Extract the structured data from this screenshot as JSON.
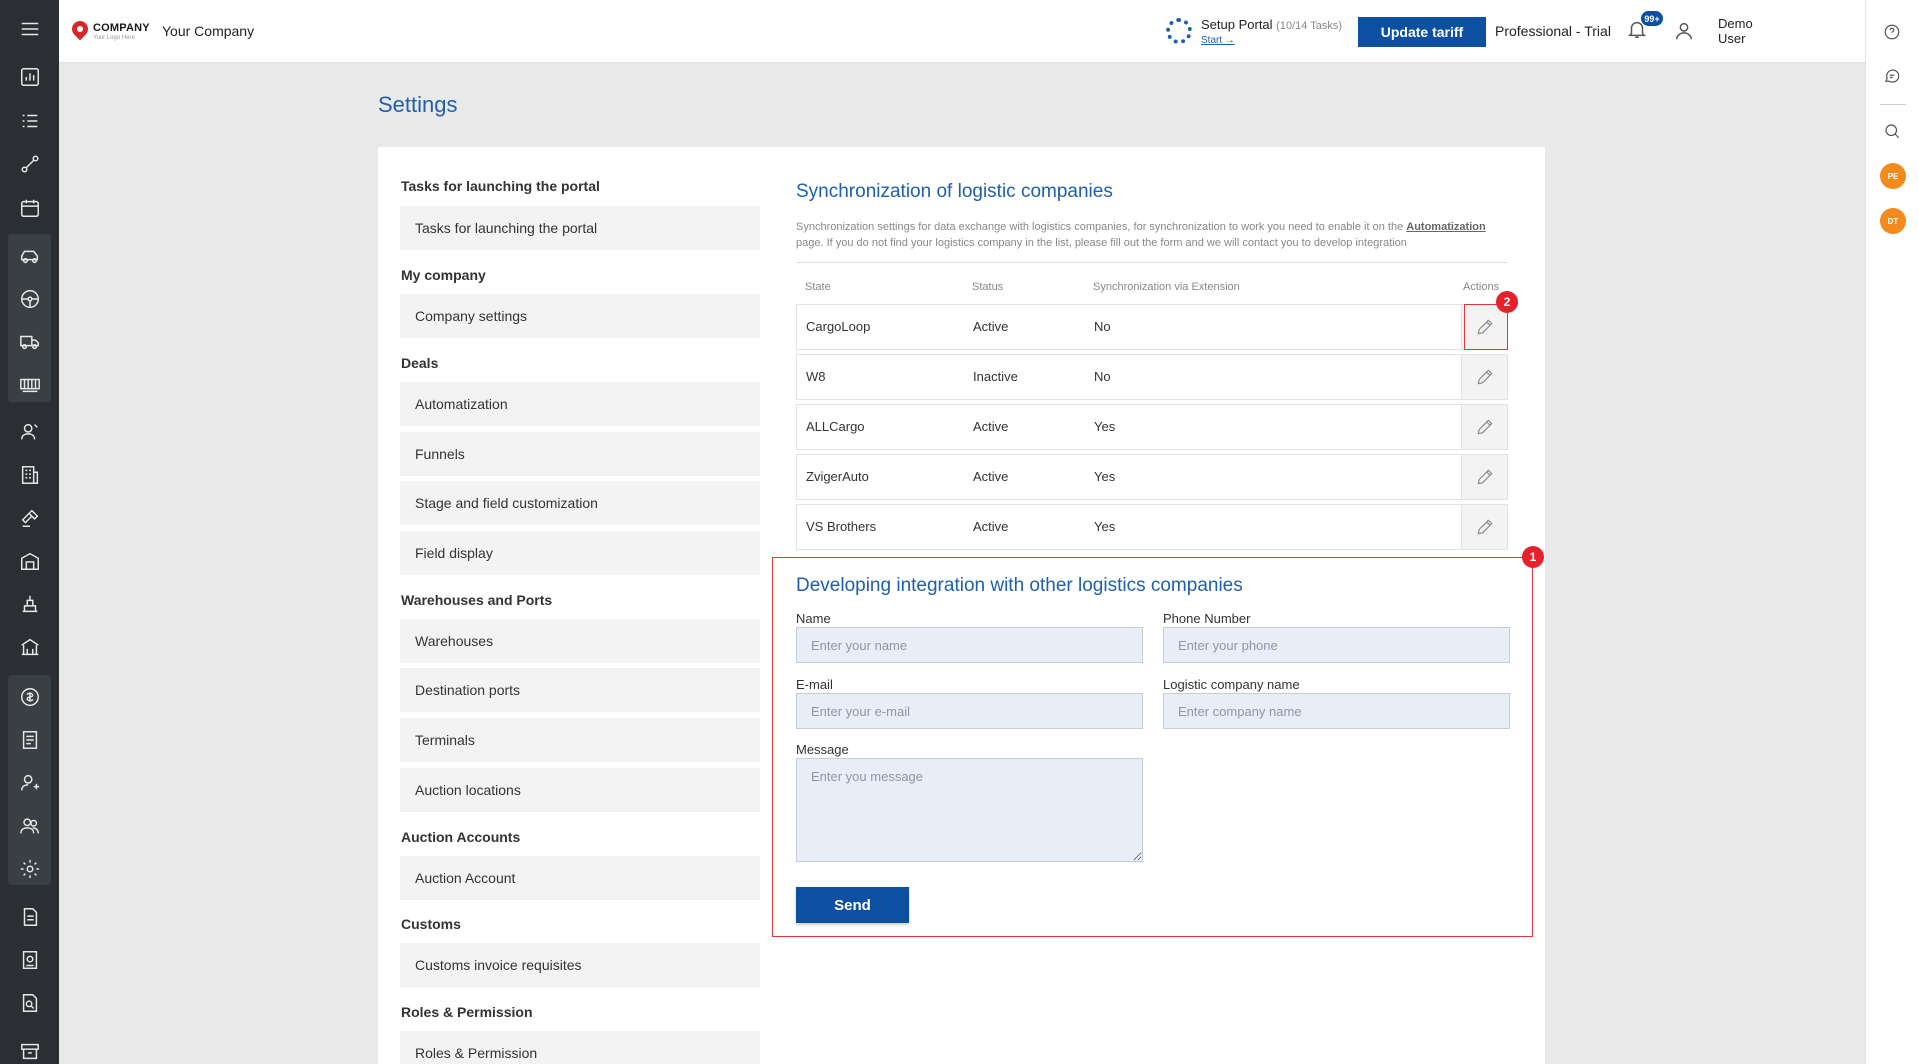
{
  "header": {
    "logo_text": "COMPANY",
    "logo_tagline": "Your Logo Here",
    "company_name": "Your Company",
    "setup_title": "Setup Portal",
    "setup_tasks": "(10/14 Tasks)",
    "setup_start": "Start →",
    "update_button": "Update tariff",
    "plan": "Professional - Trial",
    "notifications_badge": "99+",
    "user_name": "Demo User"
  },
  "page": {
    "title": "Settings"
  },
  "nav": {
    "sections": [
      {
        "heading": "Tasks for launching the portal",
        "items": [
          "Tasks for launching the portal"
        ]
      },
      {
        "heading": "My company",
        "items": [
          "Company settings"
        ]
      },
      {
        "heading": "Deals",
        "items": [
          "Automatization",
          "Funnels",
          "Stage and field customization",
          "Field display"
        ]
      },
      {
        "heading": "Warehouses and Ports",
        "items": [
          "Warehouses",
          "Destination ports",
          "Terminals",
          "Auction locations"
        ]
      },
      {
        "heading": "Auction Accounts",
        "items": [
          "Auction Account"
        ]
      },
      {
        "heading": "Customs",
        "items": [
          "Customs invoice requisites"
        ]
      },
      {
        "heading": "Roles & Permission",
        "items": [
          "Roles & Permission"
        ]
      }
    ]
  },
  "sync": {
    "title": "Synchronization of logistic companies",
    "desc_before": "Synchronization settings for data exchange with logistics companies, for synchronization to work you need to enable it on the ",
    "desc_link": "Automatization",
    "desc_after": " page. If you do not find your logistics company in the list, please fill out the form and we will contact you to develop integration",
    "columns": {
      "state": "State",
      "status": "Status",
      "extension": "Synchronization via Extension",
      "actions": "Actions"
    },
    "rows": [
      {
        "state": "CargoLoop",
        "status": "Active",
        "extension": "No"
      },
      {
        "state": "W8",
        "status": "Inactive",
        "extension": "No"
      },
      {
        "state": "ALLCargo",
        "status": "Active",
        "extension": "Yes"
      },
      {
        "state": "ZvigerAuto",
        "status": "Active",
        "extension": "Yes"
      },
      {
        "state": "VS Brothers",
        "status": "Active",
        "extension": "Yes"
      }
    ]
  },
  "form": {
    "title": "Developing integration with other logistics companies",
    "name_label": "Name",
    "name_placeholder": "Enter your name",
    "phone_label": "Phone Number",
    "phone_placeholder": "Enter your phone",
    "email_label": "E-mail",
    "email_placeholder": "Enter your e-mail",
    "company_label": "Logistic company name",
    "company_placeholder": "Enter company name",
    "message_label": "Message",
    "message_placeholder": "Enter you message",
    "send_button": "Send"
  },
  "annotations": {
    "marker_1": "1",
    "marker_2": "2"
  },
  "right_sidebar": {
    "avatar_1": "PE",
    "avatar_2": "DT"
  },
  "colors": {
    "accent": "#0d4fa1",
    "title_blue": "#1f5fae",
    "highlight_red": "#e5222a",
    "avatar_orange": "#f28a1c"
  }
}
